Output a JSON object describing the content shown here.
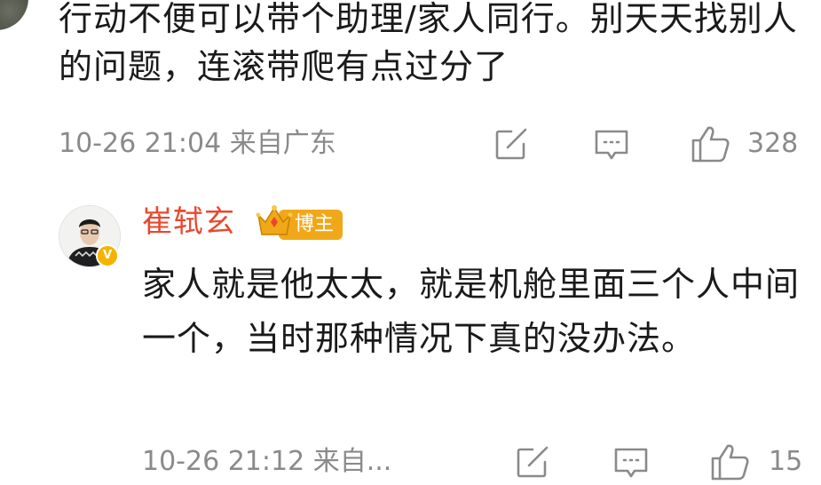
{
  "comment1": {
    "text": "行动不便可以带个助理/家人同行。别天天找别人的问题，连滚带爬有点过分了",
    "time_location": "10-26 21:04  来自广东",
    "like_count": "328"
  },
  "reply": {
    "author": "崔轼玄",
    "badge_label": "博主",
    "text": "家人就是他太太，就是机舱里面三个人中间一个，当时那种情况下真的没办法。",
    "time_location": "10-26 21:12  来自...",
    "like_count": "15"
  },
  "colors": {
    "author_name": "#e8482e",
    "badge_bg": "#f0a818",
    "meta_gray": "#8a8a8a"
  },
  "icons": [
    "share-icon",
    "comment-icon",
    "like-icon",
    "verified-icon",
    "crown-icon"
  ]
}
